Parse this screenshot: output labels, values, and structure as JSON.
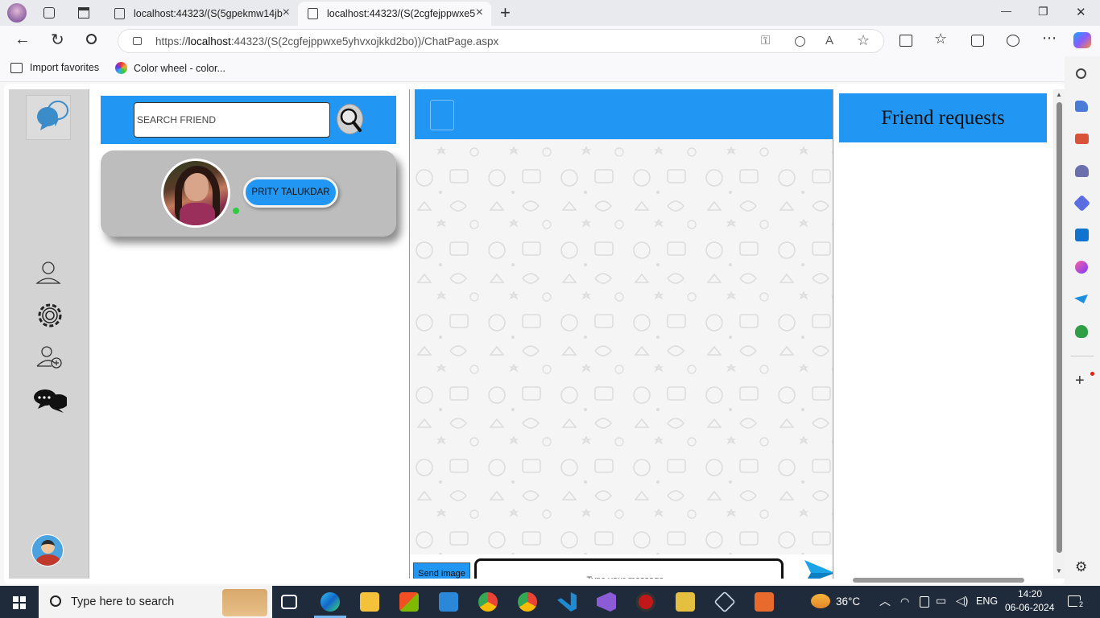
{
  "browser": {
    "tabs": [
      {
        "title": "localhost:44323/(S(5gpekmw14jb",
        "active": false
      },
      {
        "title": "localhost:44323/(S(2cgfejppwxe5",
        "active": true
      }
    ],
    "new_tab_glyph": "+",
    "url": {
      "prefix": "https://",
      "host": "localhost",
      "rest": ":44323/(S(2cgfejppwxe5yhvxojkkd2bo))/ChatPage.aspx"
    },
    "favorites": [
      {
        "label": "Import favorites",
        "icon": "import-favorites-icon"
      },
      {
        "label": "Color wheel - color...",
        "icon": "color-wheel-icon"
      }
    ],
    "window_controls": {
      "minimize": "—",
      "maximize": "❐",
      "close": "✕"
    }
  },
  "app": {
    "search": {
      "placeholder": "SEARCH FRIEND",
      "value": ""
    },
    "friends": [
      {
        "name": "PRITY TALUKDAR",
        "online": true
      }
    ],
    "rail_icons": [
      "user-icon",
      "gear-icon",
      "add-user-icon",
      "chat-bubbles-icon"
    ],
    "chat": {
      "send_image_label": "Send image",
      "message_placeholder": "Type your message...",
      "message_value": ""
    },
    "friend_requests": {
      "title": "Friend requests"
    },
    "colors": {
      "accent": "#2196f3",
      "rail": "#d3d3d3",
      "card": "#bdbdbd",
      "online": "#2ecc40"
    }
  },
  "taskbar": {
    "search_placeholder": "Type here to search",
    "weather": "36°C",
    "language": "ENG",
    "time": "14:20",
    "date": "06-06-2024",
    "notifications": "2"
  }
}
